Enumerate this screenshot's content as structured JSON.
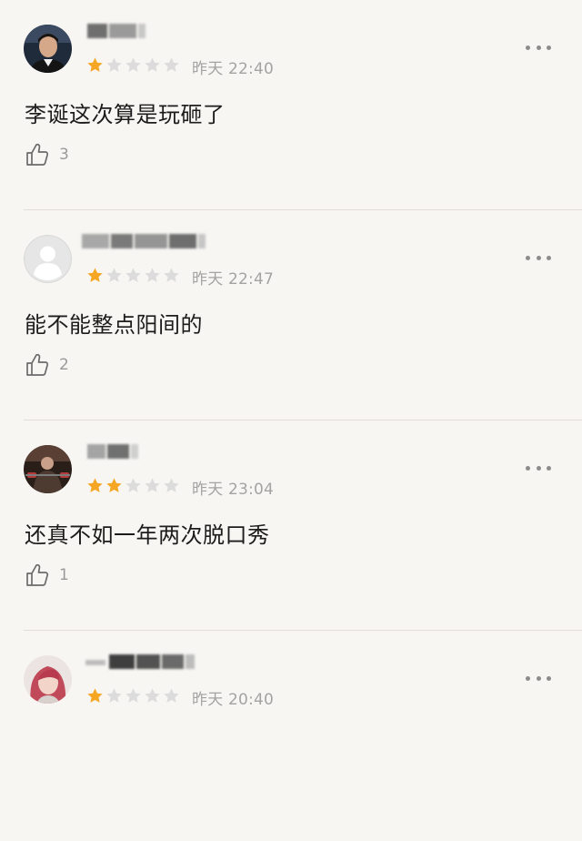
{
  "reviews": [
    {
      "username": "",
      "rating": 1,
      "max_rating": 5,
      "time": "昨天 22:40",
      "content": "李诞这次算是玩砸了",
      "likes": "3",
      "avatar": "person-photo"
    },
    {
      "username": "",
      "rating": 1,
      "max_rating": 5,
      "time": "昨天 22:47",
      "content": "能不能整点阳间的",
      "likes": "2",
      "avatar": "default-gray"
    },
    {
      "username": "",
      "rating": 2,
      "max_rating": 5,
      "time": "昨天 23:04",
      "content": "还真不如一年两次脱口秀",
      "likes": "1",
      "avatar": "gym-photo"
    },
    {
      "username": "",
      "rating": 1,
      "max_rating": 5,
      "time": "昨天 20:40",
      "content": "",
      "likes": "",
      "avatar": "pink-hair-photo"
    }
  ],
  "colors": {
    "star_filled": "#f5a623",
    "star_empty": "#dcdcdc",
    "background": "#f8f6f3",
    "meta_text": "#a3a3a3"
  },
  "icons": {
    "like": "thumbs-up-icon",
    "more": "more-horizontal-icon",
    "star": "star-icon"
  }
}
